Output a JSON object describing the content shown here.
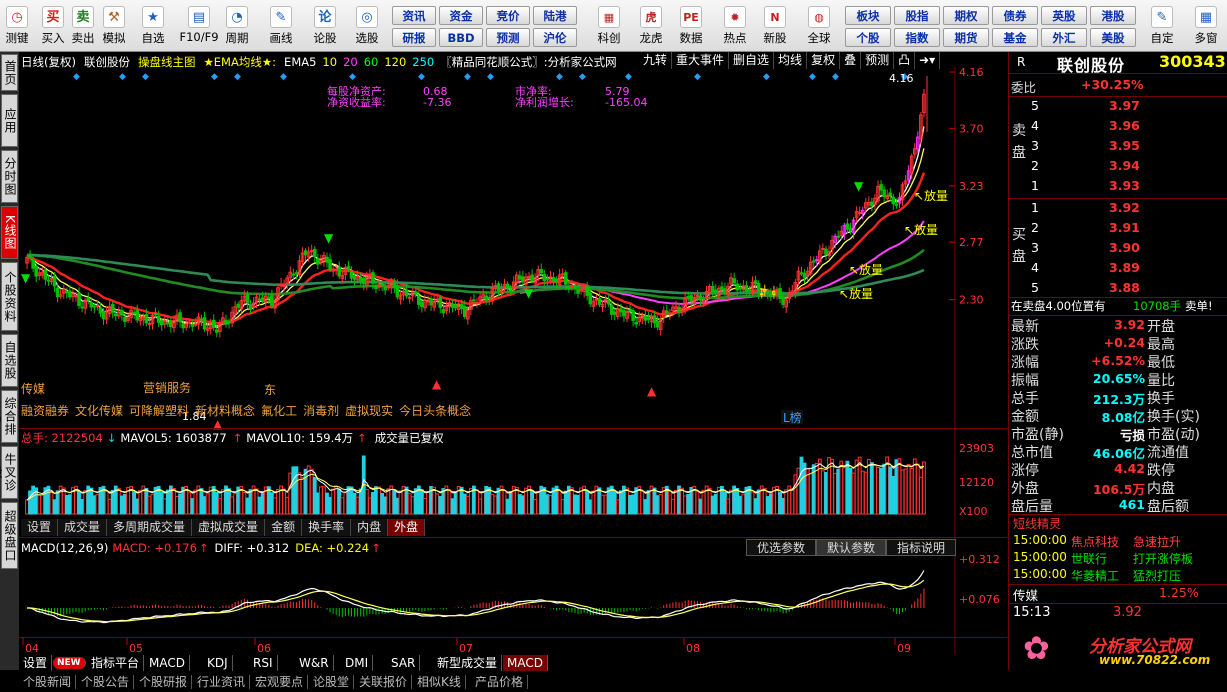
{
  "toolbar": {
    "items": [
      {
        "label": "测键",
        "icon": "clock-icon",
        "color": "#d03030",
        "glyph": "◷"
      },
      {
        "label": "买入",
        "icon": "buy-icon",
        "color": "#d02020",
        "glyph": "买"
      },
      {
        "label": "卖出",
        "icon": "sell-icon",
        "color": "#208020",
        "glyph": "卖"
      },
      {
        "label": "模拟",
        "icon": "hammer-icon",
        "color": "#b06020",
        "glyph": "⚒"
      },
      {
        "label": "自选",
        "icon": "star-icon",
        "color": "#2060c0",
        "glyph": "★"
      },
      {
        "label": "F10/F9",
        "icon": "f10-icon",
        "color": "#2060c0",
        "glyph": "▤"
      },
      {
        "label": "周期",
        "icon": "period-icon",
        "color": "#2060c0",
        "glyph": "◔"
      },
      {
        "label": "画线",
        "icon": "pencil-icon",
        "color": "#2060c0",
        "glyph": "✎"
      },
      {
        "label": "论股",
        "icon": "forum-icon",
        "color": "#2060c0",
        "glyph": "论"
      },
      {
        "label": "选股",
        "icon": "select-stock-icon",
        "color": "#2060c0",
        "glyph": "◎"
      }
    ],
    "buttons_top": [
      "资讯",
      "资金",
      "竞价",
      "陆港"
    ],
    "buttons_bottom": [
      "研报",
      "BBD",
      "预测",
      "沪伦"
    ],
    "items2": [
      {
        "label": "科创",
        "icon": "chart-icon",
        "glyph": "▦"
      },
      {
        "label": "龙虎",
        "icon": "tiger-icon",
        "glyph": "虎"
      },
      {
        "label": "数据",
        "icon": "pe-icon",
        "glyph": "PE"
      },
      {
        "label": "热点",
        "icon": "fire-icon",
        "glyph": "✹"
      },
      {
        "label": "新股",
        "icon": "newstock-icon",
        "glyph": "N"
      },
      {
        "label": "全球",
        "icon": "globe-icon",
        "glyph": "◍"
      }
    ],
    "buttons2_top": [
      "板块",
      "股指",
      "期权",
      "债券",
      "英股",
      "港股"
    ],
    "buttons2_bottom": [
      "个股",
      "指数",
      "期货",
      "基金",
      "外汇",
      "美股"
    ],
    "items3": [
      {
        "label": "自定",
        "icon": "custom-icon",
        "glyph": "✎"
      },
      {
        "label": "多窗",
        "icon": "multiwindow-icon",
        "glyph": "▦"
      }
    ]
  },
  "leftnav": [
    "首页",
    "应用",
    "分时图",
    "K线图",
    "个股资料",
    "自选股",
    "综合排名",
    "牛叉诊股",
    "超级盘口"
  ],
  "chart": {
    "legend_items": [
      {
        "text": "日线(复权)",
        "color": "#ffffff"
      },
      {
        "text": "联创股份",
        "color": "#ffffff"
      },
      {
        "text": "操盘线主图",
        "color": "#ffff00"
      },
      {
        "text": "★EMA均线★:",
        "color": "#ffff00"
      },
      {
        "text": "EMA5",
        "color": "#ffffff"
      },
      {
        "text": "10",
        "color": "#ffff00"
      },
      {
        "text": "20",
        "color": "#ff40ff"
      },
      {
        "text": "60",
        "color": "#00ff00"
      },
      {
        "text": "120",
        "color": "#ffff00"
      },
      {
        "text": "250",
        "color": "#00ffff"
      },
      {
        "text": "〖精品同花顺公式〗:分析家公式网",
        "color": "#ffffff"
      }
    ],
    "top_tabs": [
      "九转",
      "重大事件",
      "删自选",
      "均线",
      "复权",
      "叠",
      "预测",
      "凸"
    ],
    "fundamentals": [
      {
        "label": "每股净资产:",
        "value": "0.68"
      },
      {
        "label": "市净率:",
        "value": "5.79"
      },
      {
        "label": "净资收益率:",
        "value": "-7.36"
      },
      {
        "label": "净利润增长:",
        "value": "-165.04"
      }
    ],
    "price_axis": [
      "4.16",
      "3.70",
      "3.23",
      "2.77",
      "2.30"
    ],
    "high_label": "4.16",
    "low_label": "1.84",
    "annotations": [
      "放量",
      "放量",
      "放量",
      "放量"
    ],
    "concepts_line1": "传媒",
    "concept_icon_text": "营销服务",
    "concepts_line2": [
      "融资融券",
      "文化传媒",
      "可降解塑料",
      "新材料概念",
      "氟化工",
      "消毒剂",
      "虚拟现实",
      "今日头条概念"
    ],
    "tag_note": "东",
    "tag_rank": "L榜",
    "volume_legend": {
      "total": "总手: 2122504",
      "mavol5": "MAVOL5: 1603877",
      "mavol10": "MAVOL10: 159.4万",
      "note": "成交量已复权"
    },
    "volume_axis": [
      "23903",
      "12120",
      "X100"
    ],
    "vol_tabs": [
      "设置",
      "成交量",
      "多周期成交量",
      "虚拟成交量",
      "金额",
      "换手率",
      "内盘",
      "外盘"
    ],
    "macd_legend": {
      "name": "MACD(12,26,9)",
      "macd": "MACD: +0.176",
      "diff": "DIFF: +0.312",
      "dea": "DEA: +0.224"
    },
    "macd_buttons": [
      "优选参数",
      "默认参数",
      "指标说明"
    ],
    "macd_axis": [
      "+0.312",
      "+0.076"
    ],
    "months": [
      "04",
      "05",
      "06",
      "07",
      "08",
      "09"
    ]
  },
  "chart_data": {
    "type": "candlestick",
    "title": "联创股份 日线(复权)",
    "ylim": [
      1.84,
      4.16
    ],
    "x": [
      "04",
      "05",
      "06",
      "07",
      "08",
      "09"
    ],
    "series": [
      {
        "name": "K线",
        "values": [
          2.6,
          2.38,
          2.14,
          2.04,
          2.16,
          2.3,
          2.76,
          2.48,
          2.22,
          2.46,
          2.32,
          2.16,
          2.36,
          2.56,
          2.5,
          3.2,
          3.1,
          3.92
        ]
      }
    ]
  },
  "bottom_tabs": [
    "设置",
    "NEW",
    "指标平台",
    "MACD",
    "KDJ",
    "RSI",
    "W&R",
    "DMI",
    "SAR",
    "新型成交量",
    "MACD"
  ],
  "bottom_tabs2": [
    "个股新闻",
    "个股公告",
    "个股研报",
    "行业资讯",
    "宏观要点",
    "论股堂",
    "关联报价",
    "相似K线",
    "产品价格"
  ],
  "quote": {
    "stock_name": "联创股份",
    "stock_code": "300343",
    "r_label": "R",
    "weibi_label": "委比",
    "weibi": "+30.25%",
    "sell_label": "卖盘",
    "buy_label": "买盘",
    "sell": [
      {
        "n": "5",
        "p": "3.97"
      },
      {
        "n": "4",
        "p": "3.96"
      },
      {
        "n": "3",
        "p": "3.95"
      },
      {
        "n": "2",
        "p": "3.94"
      },
      {
        "n": "1",
        "p": "3.93"
      }
    ],
    "buy": [
      {
        "n": "1",
        "p": "3.92"
      },
      {
        "n": "2",
        "p": "3.91"
      },
      {
        "n": "3",
        "p": "3.90"
      },
      {
        "n": "4",
        "p": "3.89"
      },
      {
        "n": "5",
        "p": "3.88"
      }
    ],
    "alert_prefix": "在卖盘4.00位置有",
    "alert_vol": "10708手",
    "alert_suffix": "卖单!",
    "stats": [
      {
        "l": "最新",
        "v": "3.92",
        "l2": "开盘",
        "v2": ""
      },
      {
        "l": "涨跌",
        "v": "+0.24",
        "l2": "最高",
        "v2": ""
      },
      {
        "l": "涨幅",
        "v": "+6.52%",
        "l2": "最低",
        "v2": ""
      },
      {
        "l": "振幅",
        "v": "20.65%",
        "l2": "量比",
        "v2": ""
      },
      {
        "l": "总手",
        "v": "212.3万",
        "l2": "换手",
        "v2": ""
      },
      {
        "l": "金额",
        "v": "8.08亿",
        "l2": "换手(实)",
        "v2": ""
      },
      {
        "l": "市盈(静)",
        "v": "亏损",
        "l2": "市盈(动)",
        "v2": ""
      },
      {
        "l": "总市值",
        "v": "46.06亿",
        "l2": "流通值",
        "v2": ""
      },
      {
        "l": "涨停",
        "v": "4.42",
        "l2": "跌停",
        "v2": ""
      },
      {
        "l": "外盘",
        "v": "106.5万",
        "l2": "内盘",
        "v2": ""
      },
      {
        "l": "盘后量",
        "v": "461",
        "l2": "盘后额",
        "v2": ""
      }
    ],
    "elf_title": "短线精灵",
    "elf": [
      {
        "t": "15:00:00",
        "s": "焦点科技",
        "e": "急速拉升",
        "c": "#ff4040"
      },
      {
        "t": "15:00:00",
        "s": "世联行",
        "e": "打开涨停板",
        "c": "#00e000"
      },
      {
        "t": "15:00:00",
        "s": "华菱精工",
        "e": "猛烈打压",
        "c": "#00e000"
      }
    ],
    "sector": "传媒",
    "sector_pct": "1.25%",
    "time": "15:13",
    "last": "3.92",
    "logo_title": "分析家公式网",
    "logo_url": "www.70822.com"
  }
}
